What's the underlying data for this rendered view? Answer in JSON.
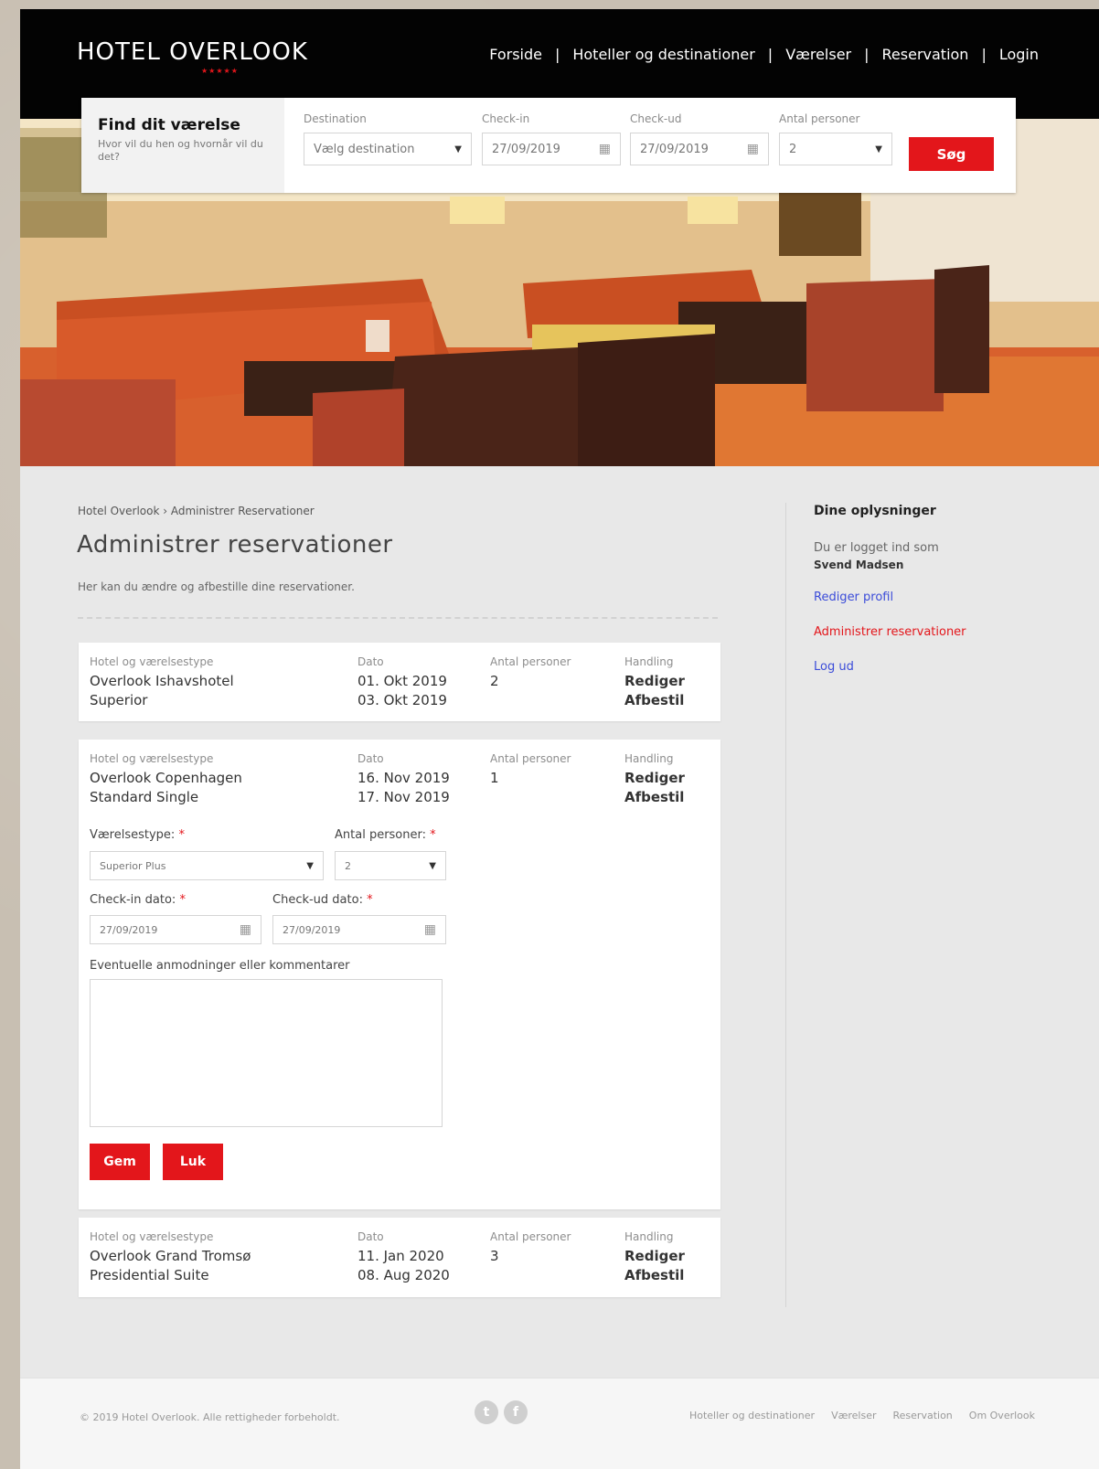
{
  "brand": {
    "name": "HOTEL OVERLOOK",
    "stars": "★★★★★"
  },
  "nav": [
    "Forside",
    "Hoteller og destinationer",
    "Værelser",
    "Reservation",
    "Login"
  ],
  "search": {
    "title": "Find dit værelse",
    "subtitle": "Hvor vil du hen og hvornår vil du det?",
    "destination_label": "Destination",
    "destination_value": "Vælg destination",
    "checkin_label": "Check-in",
    "checkin_value": "27/09/2019",
    "checkout_label": "Check-ud",
    "checkout_value": "27/09/2019",
    "persons_label": "Antal personer",
    "persons_value": "2",
    "button": "Søg"
  },
  "breadcrumb": "Hotel Overlook › Administrer Reservationer",
  "page_title": "Administrer reservationer",
  "page_desc": "Her kan du ændre og afbestille dine reservationer.",
  "columns": {
    "hotel": "Hotel og værelsestype",
    "date": "Dato",
    "persons": "Antal personer",
    "action": "Handling"
  },
  "actions": {
    "edit": "Rediger",
    "cancel": "Afbestil"
  },
  "reservations": [
    {
      "hotel": "Overlook Ishavshotel",
      "room": "Superior",
      "from": "01. Okt 2019",
      "to": "03. Okt 2019",
      "persons": "2"
    },
    {
      "hotel": "Overlook Copenhagen",
      "room": "Standard Single",
      "from": "16. Nov 2019",
      "to": "17. Nov 2019",
      "persons": "1"
    },
    {
      "hotel": "Overlook Grand Tromsø",
      "room": "Presidential Suite",
      "from": "11. Jan 2020",
      "to": "08. Aug 2020",
      "persons": "3"
    }
  ],
  "edit_form": {
    "roomtype_label": "Værelsestype:",
    "roomtype_value": "Superior Plus",
    "persons_label": "Antal personer:",
    "persons_value": "2",
    "checkin_label": "Check-in dato:",
    "checkin_value": "27/09/2019",
    "checkout_label": "Check-ud dato:",
    "checkout_value": "27/09/2019",
    "comments_label": "Eventuelle anmodninger eller kommentarer",
    "save": "Gem",
    "close": "Luk"
  },
  "sidebar": {
    "title": "Dine oplysninger",
    "logged_in": "Du er logget ind som",
    "user": "Svend Madsen",
    "edit_profile": "Rediger profil",
    "manage": "Administrer reservationer",
    "logout": "Log ud",
    "link_color": "#3b4cd9",
    "active_color": "#e3161b"
  },
  "footer": {
    "copyright": "© 2019 Hotel Overlook. Alle rettigheder forbeholdt.",
    "links": [
      "Hoteller og destinationer",
      "Værelser",
      "Reservation",
      "Om Overlook"
    ]
  }
}
